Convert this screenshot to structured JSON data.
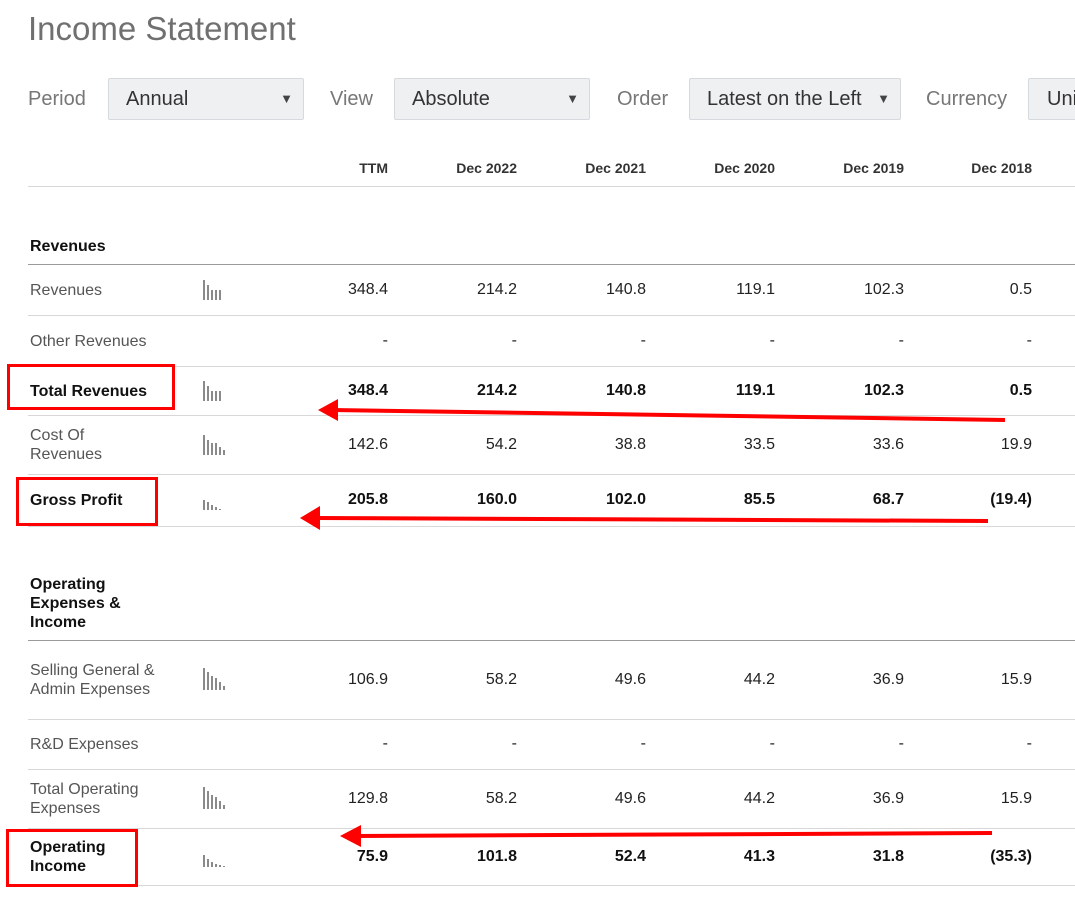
{
  "page_title": "Income Statement",
  "filters": {
    "period_label": "Period",
    "period_value": "Annual",
    "view_label": "View",
    "view_value": "Absolute",
    "order_label": "Order",
    "order_value": "Latest on the Left",
    "currency_label": "Currency",
    "currency_value": "Uni"
  },
  "columns": [
    "TTM",
    "Dec 2022",
    "Dec 2021",
    "Dec 2020",
    "Dec 2019",
    "Dec 2018"
  ],
  "sections": {
    "revenues": "Revenues",
    "opex": "Operating Expenses & Income"
  },
  "rows": [
    {
      "label": "Revenues",
      "values": [
        "348.4",
        "214.2",
        "140.8",
        "119.1",
        "102.3",
        "0.5"
      ],
      "bold": false,
      "has_chart": true
    },
    {
      "label": "Other Revenues",
      "values": [
        "-",
        "-",
        "-",
        "-",
        "-",
        "-"
      ],
      "bold": false,
      "has_chart": false
    },
    {
      "label": "Total Revenues",
      "values": [
        "348.4",
        "214.2",
        "140.8",
        "119.1",
        "102.3",
        "0.5"
      ],
      "bold": true,
      "has_chart": true
    },
    {
      "label": "Cost Of Revenues",
      "values": [
        "142.6",
        "54.2",
        "38.8",
        "33.5",
        "33.6",
        "19.9"
      ],
      "bold": false,
      "has_chart": true
    },
    {
      "label": "Gross Profit",
      "values": [
        "205.8",
        "160.0",
        "102.0",
        "85.5",
        "68.7",
        "(19.4)"
      ],
      "bold": true,
      "has_chart": true
    },
    {
      "label": "Selling General & Admin Expenses",
      "values": [
        "106.9",
        "58.2",
        "49.6",
        "44.2",
        "36.9",
        "15.9"
      ],
      "bold": false,
      "has_chart": true
    },
    {
      "label": "R&D Expenses",
      "values": [
        "-",
        "-",
        "-",
        "-",
        "-",
        "-"
      ],
      "bold": false,
      "has_chart": false
    },
    {
      "label": "Total Operating Expenses",
      "values": [
        "129.8",
        "58.2",
        "49.6",
        "44.2",
        "36.9",
        "15.9"
      ],
      "bold": false,
      "has_chart": true
    },
    {
      "label": "Operating Income",
      "values": [
        "75.9",
        "101.8",
        "52.4",
        "41.3",
        "31.8",
        "(35.3)"
      ],
      "bold": true,
      "has_chart": true
    }
  ],
  "icons": {
    "sparkline": "mini-bar-chart-icon",
    "dropdown": "caret-down-icon"
  },
  "colors": {
    "annotation": "#ff0000"
  }
}
